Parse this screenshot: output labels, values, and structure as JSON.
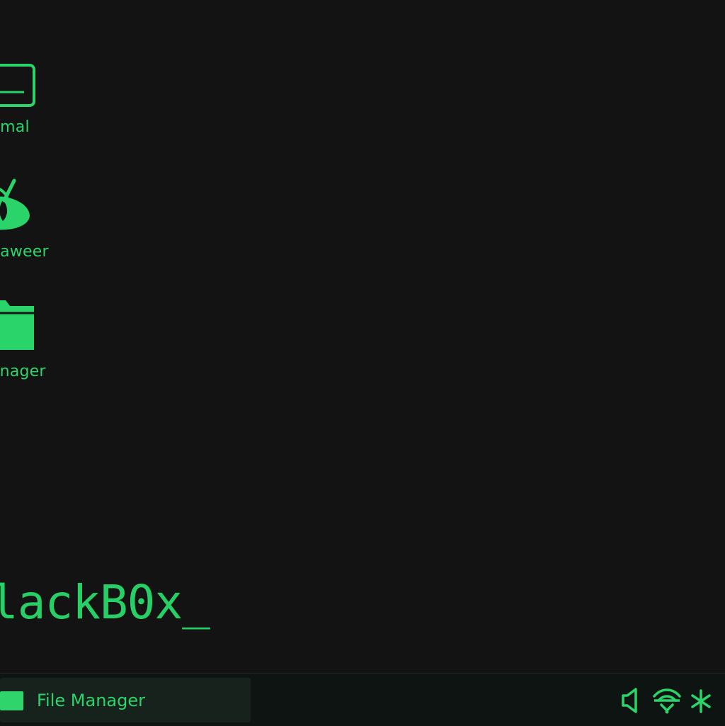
{
  "desktop": {
    "icons": [
      {
        "label": "umal",
        "icon": "terminal-icon"
      },
      {
        "label": "paweer",
        "icon": "paint-icon"
      },
      {
        "label": "anager",
        "icon": "folder-icon"
      }
    ],
    "brand_text": "lackB0x_"
  },
  "taskbar": {
    "window_button": {
      "label": "File Manager",
      "icon": "folder-icon"
    },
    "tray": [
      "volume-icon",
      "network-icon",
      "bluetooth-icon"
    ]
  },
  "colors": {
    "accent": "#2bd46a",
    "background": "#131313",
    "taskbar": "#0e1411",
    "taskbar_button": "#18221c"
  }
}
